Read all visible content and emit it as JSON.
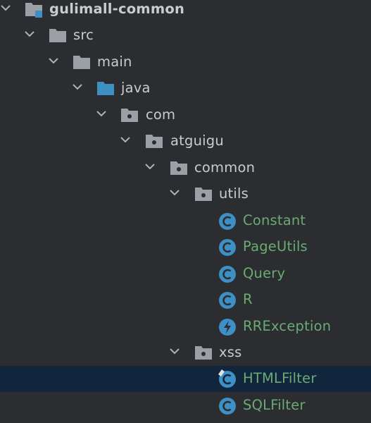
{
  "colors": {
    "background": "#2b2d30",
    "selected_row": "#11263d",
    "folder_gray": "#9aa0a6",
    "source_folder_blue": "#3d8fc4",
    "class_icon_teal": "#3d8fc4",
    "class_name_green": "#6aab73",
    "folder_text": "#c9cbce"
  },
  "tree": {
    "nodes": [
      {
        "label": "gulimall-common",
        "icon": "module-folder-icon",
        "expanded": true
      },
      {
        "label": "src",
        "icon": "folder-icon",
        "expanded": true
      },
      {
        "label": "main",
        "icon": "folder-icon",
        "expanded": true
      },
      {
        "label": "java",
        "icon": "source-root-folder-icon",
        "expanded": true
      },
      {
        "label": "com",
        "icon": "package-icon",
        "expanded": true
      },
      {
        "label": "atguigu",
        "icon": "package-icon",
        "expanded": true
      },
      {
        "label": "common",
        "icon": "package-icon",
        "expanded": true
      },
      {
        "label": "utils",
        "icon": "package-icon",
        "expanded": true
      },
      {
        "label": "Constant",
        "icon": "class-icon"
      },
      {
        "label": "PageUtils",
        "icon": "class-icon"
      },
      {
        "label": "Query",
        "icon": "class-icon"
      },
      {
        "label": "R",
        "icon": "class-icon"
      },
      {
        "label": "RRException",
        "icon": "exception-class-icon"
      },
      {
        "label": "xss",
        "icon": "package-icon",
        "expanded": true
      },
      {
        "label": "HTMLFilter",
        "icon": "class-icon",
        "selected": true
      },
      {
        "label": "SQLFilter",
        "icon": "class-icon"
      }
    ]
  }
}
